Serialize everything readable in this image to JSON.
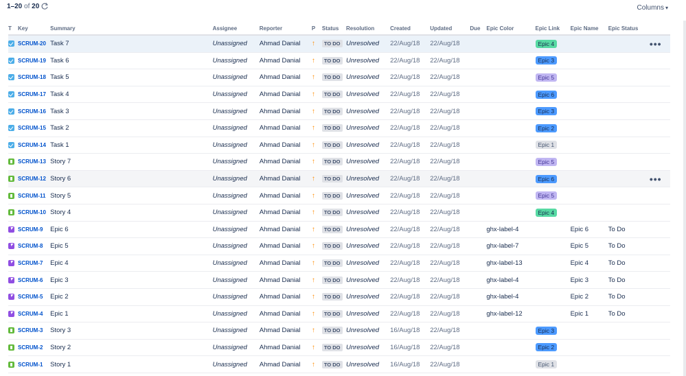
{
  "pager": {
    "range": "1–20",
    "of_label": "of",
    "total": "20"
  },
  "columns_button": "Columns",
  "headers": {
    "type": "T",
    "key": "Key",
    "summary": "Summary",
    "assignee": "Assignee",
    "reporter": "Reporter",
    "priority": "P",
    "status": "Status",
    "resolution": "Resolution",
    "created": "Created",
    "updated": "Updated",
    "due": "Due",
    "epic_color": "Epic Color",
    "epic_link": "Epic Link",
    "epic_name": "Epic Name",
    "epic_status": "Epic Status"
  },
  "colors": {
    "epic_lozenges": {
      "Epic 1": {
        "bg": "#dfe1e6",
        "fg": "#42526e"
      },
      "Epic 2": {
        "bg": "#4c9aff",
        "fg": "#172b4d"
      },
      "Epic 3": {
        "bg": "#4c9aff",
        "fg": "#172b4d"
      },
      "Epic 4": {
        "bg": "#57d9a3",
        "fg": "#172b4d"
      },
      "Epic 5": {
        "bg": "#c0b6f2",
        "fg": "#403294"
      },
      "Epic 6": {
        "bg": "#4c9aff",
        "fg": "#172b4d"
      }
    }
  },
  "rows": [
    {
      "type": "task",
      "key": "SCRUM-20",
      "summary": "Task 7",
      "assignee": "Unassigned",
      "reporter": "Ahmad Danial",
      "priority_icon": "arrow-up-icon",
      "status": "TO DO",
      "resolution": "Unresolved",
      "created": "22/Aug/18",
      "updated": "22/Aug/18",
      "due": "",
      "epic_color": "",
      "epic_link": "Epic 4",
      "epic_name": "",
      "epic_status": "",
      "actions": "•••",
      "highlight": "hl"
    },
    {
      "type": "task",
      "key": "SCRUM-19",
      "summary": "Task 6",
      "assignee": "Unassigned",
      "reporter": "Ahmad Danial",
      "priority_icon": "arrow-up-icon",
      "status": "TO DO",
      "resolution": "Unresolved",
      "created": "22/Aug/18",
      "updated": "22/Aug/18",
      "due": "",
      "epic_color": "",
      "epic_link": "Epic 3",
      "epic_name": "",
      "epic_status": "",
      "actions": ""
    },
    {
      "type": "task",
      "key": "SCRUM-18",
      "summary": "Task 5",
      "assignee": "Unassigned",
      "reporter": "Ahmad Danial",
      "priority_icon": "arrow-up-icon",
      "status": "TO DO",
      "resolution": "Unresolved",
      "created": "22/Aug/18",
      "updated": "22/Aug/18",
      "due": "",
      "epic_color": "",
      "epic_link": "Epic 5",
      "epic_name": "",
      "epic_status": "",
      "actions": ""
    },
    {
      "type": "task",
      "key": "SCRUM-17",
      "summary": "Task 4",
      "assignee": "Unassigned",
      "reporter": "Ahmad Danial",
      "priority_icon": "arrow-up-icon",
      "status": "TO DO",
      "resolution": "Unresolved",
      "created": "22/Aug/18",
      "updated": "22/Aug/18",
      "due": "",
      "epic_color": "",
      "epic_link": "Epic 6",
      "epic_name": "",
      "epic_status": "",
      "actions": ""
    },
    {
      "type": "task",
      "key": "SCRUM-16",
      "summary": "Task 3",
      "assignee": "Unassigned",
      "reporter": "Ahmad Danial",
      "priority_icon": "arrow-up-icon",
      "status": "TO DO",
      "resolution": "Unresolved",
      "created": "22/Aug/18",
      "updated": "22/Aug/18",
      "due": "",
      "epic_color": "",
      "epic_link": "Epic 3",
      "epic_name": "",
      "epic_status": "",
      "actions": ""
    },
    {
      "type": "task",
      "key": "SCRUM-15",
      "summary": "Task 2",
      "assignee": "Unassigned",
      "reporter": "Ahmad Danial",
      "priority_icon": "arrow-up-icon",
      "status": "TO DO",
      "resolution": "Unresolved",
      "created": "22/Aug/18",
      "updated": "22/Aug/18",
      "due": "",
      "epic_color": "",
      "epic_link": "Epic 2",
      "epic_name": "",
      "epic_status": "",
      "actions": ""
    },
    {
      "type": "task",
      "key": "SCRUM-14",
      "summary": "Task 1",
      "assignee": "Unassigned",
      "reporter": "Ahmad Danial",
      "priority_icon": "arrow-up-icon",
      "status": "TO DO",
      "resolution": "Unresolved",
      "created": "22/Aug/18",
      "updated": "22/Aug/18",
      "due": "",
      "epic_color": "",
      "epic_link": "Epic 1",
      "epic_name": "",
      "epic_status": "",
      "actions": ""
    },
    {
      "type": "story",
      "key": "SCRUM-13",
      "summary": "Story 7",
      "assignee": "Unassigned",
      "reporter": "Ahmad Danial",
      "priority_icon": "arrow-up-icon",
      "status": "TO DO",
      "resolution": "Unresolved",
      "created": "22/Aug/18",
      "updated": "22/Aug/18",
      "due": "",
      "epic_color": "",
      "epic_link": "Epic 5",
      "epic_name": "",
      "epic_status": "",
      "actions": ""
    },
    {
      "type": "story",
      "key": "SCRUM-12",
      "summary": "Story 6",
      "assignee": "Unassigned",
      "reporter": "Ahmad Danial",
      "priority_icon": "arrow-up-icon",
      "status": "TO DO",
      "resolution": "Unresolved",
      "created": "22/Aug/18",
      "updated": "22/Aug/18",
      "due": "",
      "epic_color": "",
      "epic_link": "Epic 6",
      "epic_name": "",
      "epic_status": "",
      "actions": "•••",
      "highlight": "hl2"
    },
    {
      "type": "story",
      "key": "SCRUM-11",
      "summary": "Story 5",
      "assignee": "Unassigned",
      "reporter": "Ahmad Danial",
      "priority_icon": "arrow-up-icon",
      "status": "TO DO",
      "resolution": "Unresolved",
      "created": "22/Aug/18",
      "updated": "22/Aug/18",
      "due": "",
      "epic_color": "",
      "epic_link": "Epic 5",
      "epic_name": "",
      "epic_status": "",
      "actions": ""
    },
    {
      "type": "story",
      "key": "SCRUM-10",
      "summary": "Story 4",
      "assignee": "Unassigned",
      "reporter": "Ahmad Danial",
      "priority_icon": "arrow-up-icon",
      "status": "TO DO",
      "resolution": "Unresolved",
      "created": "22/Aug/18",
      "updated": "22/Aug/18",
      "due": "",
      "epic_color": "",
      "epic_link": "Epic 4",
      "epic_name": "",
      "epic_status": "",
      "actions": ""
    },
    {
      "type": "epic",
      "key": "SCRUM-9",
      "summary": "Epic 6",
      "assignee": "Unassigned",
      "reporter": "Ahmad Danial",
      "priority_icon": "arrow-up-icon",
      "status": "TO DO",
      "resolution": "Unresolved",
      "created": "22/Aug/18",
      "updated": "22/Aug/18",
      "due": "",
      "epic_color": "ghx-label-4",
      "epic_link": "",
      "epic_name": "Epic 6",
      "epic_status": "To Do",
      "actions": ""
    },
    {
      "type": "epic",
      "key": "SCRUM-8",
      "summary": "Epic 5",
      "assignee": "Unassigned",
      "reporter": "Ahmad Danial",
      "priority_icon": "arrow-up-icon",
      "status": "TO DO",
      "resolution": "Unresolved",
      "created": "22/Aug/18",
      "updated": "22/Aug/18",
      "due": "",
      "epic_color": "ghx-label-7",
      "epic_link": "",
      "epic_name": "Epic 5",
      "epic_status": "To Do",
      "actions": ""
    },
    {
      "type": "epic",
      "key": "SCRUM-7",
      "summary": "Epic 4",
      "assignee": "Unassigned",
      "reporter": "Ahmad Danial",
      "priority_icon": "arrow-up-icon",
      "status": "TO DO",
      "resolution": "Unresolved",
      "created": "22/Aug/18",
      "updated": "22/Aug/18",
      "due": "",
      "epic_color": "ghx-label-13",
      "epic_link": "",
      "epic_name": "Epic 4",
      "epic_status": "To Do",
      "actions": ""
    },
    {
      "type": "epic",
      "key": "SCRUM-6",
      "summary": "Epic 3",
      "assignee": "Unassigned",
      "reporter": "Ahmad Danial",
      "priority_icon": "arrow-up-icon",
      "status": "TO DO",
      "resolution": "Unresolved",
      "created": "22/Aug/18",
      "updated": "22/Aug/18",
      "due": "",
      "epic_color": "ghx-label-4",
      "epic_link": "",
      "epic_name": "Epic 3",
      "epic_status": "To Do",
      "actions": ""
    },
    {
      "type": "epic",
      "key": "SCRUM-5",
      "summary": "Epic 2",
      "assignee": "Unassigned",
      "reporter": "Ahmad Danial",
      "priority_icon": "arrow-up-icon",
      "status": "TO DO",
      "resolution": "Unresolved",
      "created": "22/Aug/18",
      "updated": "22/Aug/18",
      "due": "",
      "epic_color": "ghx-label-4",
      "epic_link": "",
      "epic_name": "Epic 2",
      "epic_status": "To Do",
      "actions": ""
    },
    {
      "type": "epic",
      "key": "SCRUM-4",
      "summary": "Epic 1",
      "assignee": "Unassigned",
      "reporter": "Ahmad Danial",
      "priority_icon": "arrow-up-icon",
      "status": "TO DO",
      "resolution": "Unresolved",
      "created": "22/Aug/18",
      "updated": "22/Aug/18",
      "due": "",
      "epic_color": "ghx-label-12",
      "epic_link": "",
      "epic_name": "Epic 1",
      "epic_status": "To Do",
      "actions": ""
    },
    {
      "type": "story",
      "key": "SCRUM-3",
      "summary": "Story 3",
      "assignee": "Unassigned",
      "reporter": "Ahmad Danial",
      "priority_icon": "arrow-up-icon",
      "status": "TO DO",
      "resolution": "Unresolved",
      "created": "16/Aug/18",
      "updated": "22/Aug/18",
      "due": "",
      "epic_color": "",
      "epic_link": "Epic 3",
      "epic_name": "",
      "epic_status": "",
      "actions": ""
    },
    {
      "type": "story",
      "key": "SCRUM-2",
      "summary": "Story 2",
      "assignee": "Unassigned",
      "reporter": "Ahmad Danial",
      "priority_icon": "arrow-up-icon",
      "status": "TO DO",
      "resolution": "Unresolved",
      "created": "16/Aug/18",
      "updated": "22/Aug/18",
      "due": "",
      "epic_color": "",
      "epic_link": "Epic 2",
      "epic_name": "",
      "epic_status": "",
      "actions": ""
    },
    {
      "type": "story",
      "key": "SCRUM-1",
      "summary": "Story 1",
      "assignee": "Unassigned",
      "reporter": "Ahmad Danial",
      "priority_icon": "arrow-up-icon",
      "status": "TO DO",
      "resolution": "Unresolved",
      "created": "16/Aug/18",
      "updated": "22/Aug/18",
      "due": "",
      "epic_color": "",
      "epic_link": "Epic 1",
      "epic_name": "",
      "epic_status": "",
      "actions": ""
    }
  ]
}
